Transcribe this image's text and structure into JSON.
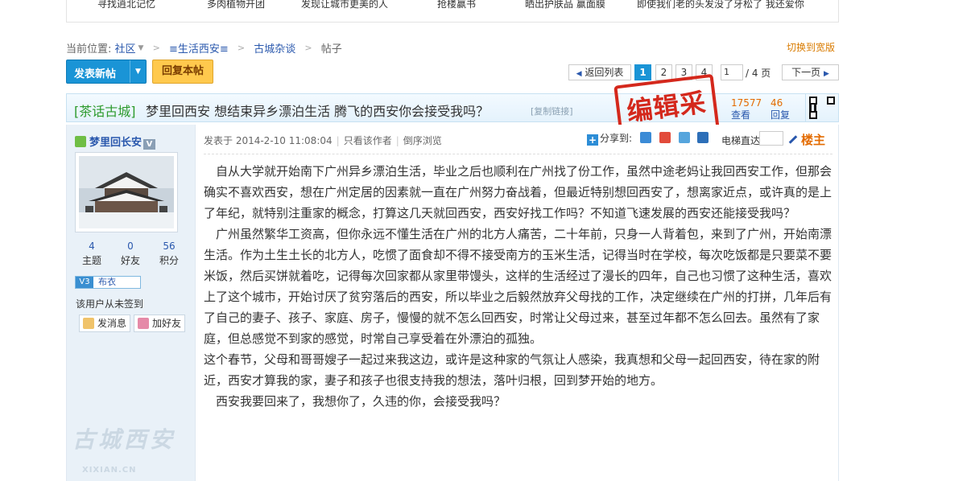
{
  "top_links": [
    "寻找逍北记忆",
    "多肉植物开团",
    "发现让城市更美的人",
    "抢楼赢书",
    "晒出护肤品 赢面膜",
    "即使我们老的头发没了牙松了 我还爱你"
  ],
  "breadcrumb": {
    "prefix": "当前位置:",
    "items": [
      "社区",
      "≡生活西安≡",
      "古城杂谈",
      "帖子"
    ]
  },
  "switch_wide": "切换到宽版",
  "toolbar": {
    "new_post": "发表新帖",
    "reply": "回复本帖"
  },
  "pagination": {
    "back": "返回列表",
    "pages": [
      "1",
      "2",
      "3",
      "4"
    ],
    "current": "1",
    "input_value": "1",
    "total": "/ 4 页",
    "next": "下一页"
  },
  "thread": {
    "category": "[茶话古城]",
    "title": "梦里回西安 想结束异乡漂泊生活 腾飞的西安你会接受我吗？",
    "copy_link": "[复制链接]",
    "views": "17577",
    "views_label": "查看",
    "replies": "46",
    "replies_label": "回复",
    "stamp": "编辑采用"
  },
  "author": {
    "name": "梦里回长安",
    "badge": "V",
    "stats": [
      {
        "value": "4",
        "label": "主题"
      },
      {
        "value": "0",
        "label": "好友"
      },
      {
        "value": "56",
        "label": "积分"
      }
    ],
    "level_tag": "V3",
    "level_name": "布衣",
    "signin": "该用户从未签到",
    "btn_message": "发消息",
    "btn_friend": "加好友"
  },
  "post": {
    "posted": "发表于 2014-2-10 11:08:04",
    "only_author": "只看该作者",
    "reverse": "倒序浏览",
    "share": "分享到:",
    "jump": "电梯直达",
    "floor": "楼主",
    "paragraphs": [
      "　自从大学就开始南下广州异乡漂泊生活，毕业之后也顺利在广州找了份工作，虽然中途老妈让我回西安工作，但那会确实不喜欢西安，想在广州定居的因素就一直在广州努力奋战着，但最近特别想回西安了，想离家近点，或许真的是上了年纪，就特别注重家的概念，打算这几天就回西安，西安好找工作吗？不知道飞速发展的西安还能接受我吗？",
      "　广州虽然繁华工资高，但你永远不懂生活在广州的北方人痛苦，二十年前，只身一人背着包，来到了广州，开始南漂生活。作为土生土长的北方人，吃惯了面食却不得不接受南方的玉米生活，记得当时在学校，每次吃饭都是只要菜不要米饭，然后买饼就着吃，记得每次回家都从家里带馒头，这样的生活经过了漫长的四年，自己也习惯了这种生活，喜欢上了这个城市，开始讨厌了贫穷落后的西安，所以毕业之后毅然放弃父母找的工作，决定继续在广州的打拼，几年后有了自己的妻子、孩子、家庭、房子，慢慢的就不怎么回西安，时常让父母过来，甚至过年都不怎么回去。虽然有了家庭，但总感觉不到家的感觉，时常自己享受着在外漂泊的孤独。",
      "这个春节，父母和哥哥嫂子一起过来我这边，或许是这种家的气氛让人感染，我真想和父母一起回西安，待在家的附近，西安才算我的家，妻子和孩子也很支持我的想法，落叶归根，回到梦开始的地方。",
      "　西安我要回来了，我想你了，久违的你，会接受我吗？"
    ]
  },
  "watermark": {
    "main": "古城西安",
    "sub": "XIXIAN.CN"
  },
  "colors": {
    "accent": "#1a94d6",
    "reply_btn": "#ffc94d",
    "stamp": "#d4281c",
    "link": "#2a58ad",
    "category": "#2c9a2c",
    "count": "#e36b00"
  }
}
